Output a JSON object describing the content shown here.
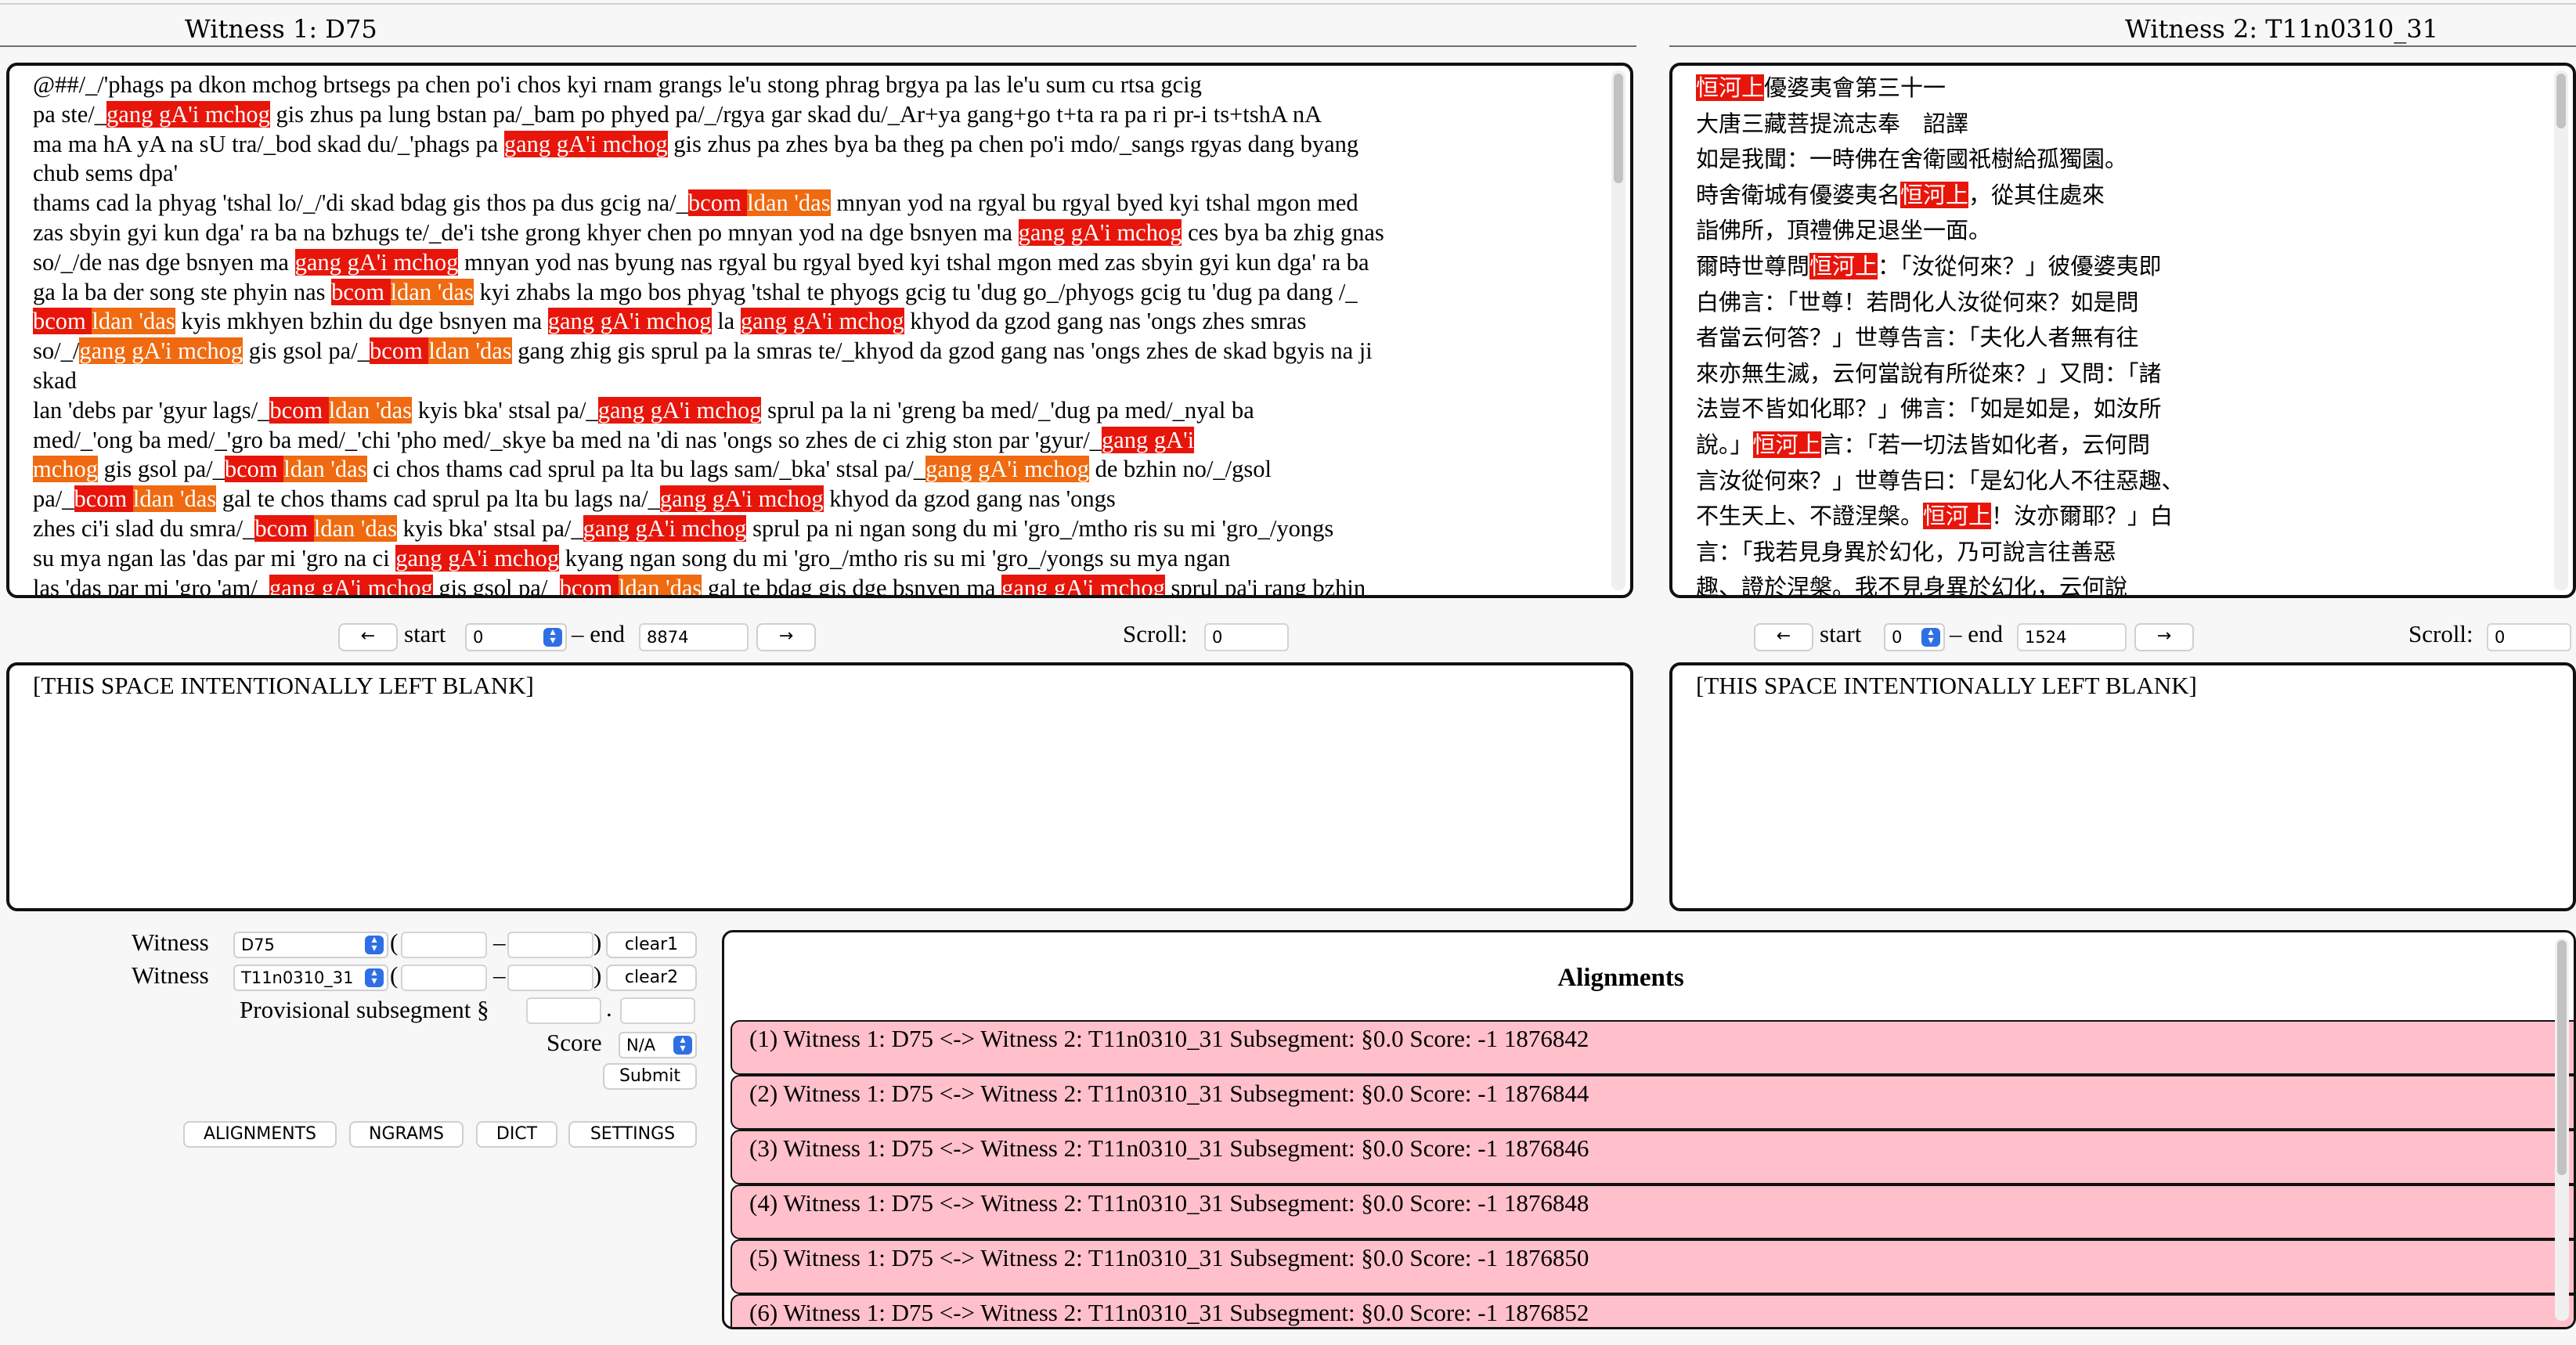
{
  "witness1": {
    "title": "Witness 1: D75",
    "lines": [
      [
        [
          "@##/_/'phags pa dkon mchog brtsegs pa chen po'i chos kyi rnam grangs le'u stong phrag brgya pa las le'u sum cu rtsa gcig",
          ""
        ]
      ],
      [
        [
          "pa ste/_",
          ""
        ],
        [
          "gang gA'i mchog",
          "a"
        ],
        [
          " gis zhus pa lung bstan pa/_bam po phyed pa/_/rgya gar skad du/_Ar+ya gang+go t+ta ra pa ri pr-i ts+tshA nA",
          ""
        ]
      ],
      [
        [
          "ma ma hA yA na sU tra/_bod skad du/_'phags pa ",
          ""
        ],
        [
          "gang gA'i mchog",
          "a"
        ],
        [
          " gis zhus pa zhes bya ba theg pa chen po'i mdo/_sangs rgyas dang byang",
          ""
        ]
      ],
      [
        [
          "chub sems dpa'",
          ""
        ]
      ],
      [
        [
          "thams cad la phyag 'tshal lo/_/'di skad bdag gis thos pa dus gcig na/_",
          ""
        ],
        [
          "bcom ",
          "a"
        ],
        [
          "ldan 'das",
          "b"
        ],
        [
          " mnyan yod na rgyal bu rgyal byed kyi tshal mgon med",
          ""
        ]
      ],
      [
        [
          "zas sbyin gyi kun dga' ra ba na bzhugs te/_de'i tshe grong khyer chen po mnyan yod na dge bsnyen ma ",
          ""
        ],
        [
          "gang gA'i mchog",
          "a"
        ],
        [
          " ces bya ba zhig gnas",
          ""
        ]
      ],
      [
        [
          "so/_/de nas dge bsnyen ma ",
          ""
        ],
        [
          "gang gA'i mchog",
          "a"
        ],
        [
          " mnyan yod nas byung nas rgyal bu rgyal byed kyi tshal mgon med zas sbyin gyi kun dga' ra ba",
          ""
        ]
      ],
      [
        [
          "ga la ba der song ste phyin nas ",
          ""
        ],
        [
          "bcom ",
          "a"
        ],
        [
          "ldan 'das",
          "b"
        ],
        [
          " kyi zhabs la mgo bos phyag 'tshal te phyogs gcig tu 'dug go_/phyogs gcig tu 'dug pa dang /_",
          ""
        ]
      ],
      [
        [
          "bcom ",
          "a"
        ],
        [
          "ldan 'das",
          "b"
        ],
        [
          " kyis mkhyen bzhin du dge bsnyen ma ",
          ""
        ],
        [
          "gang gA'i mchog",
          "a"
        ],
        [
          " la ",
          ""
        ],
        [
          "gang gA'i mchog",
          "a"
        ],
        [
          " khyod da gzod gang nas 'ongs zhes smras",
          ""
        ]
      ],
      [
        [
          "so/_/",
          ""
        ],
        [
          "gang gA'i mchog",
          "b"
        ],
        [
          " gis gsol pa/_",
          ""
        ],
        [
          "bcom ",
          "a"
        ],
        [
          "ldan 'das",
          "b"
        ],
        [
          " gang zhig gis sprul pa la smras te/_khyod da gzod gang nas 'ongs zhes de skad bgyis na ji",
          ""
        ]
      ],
      [
        [
          "skad",
          ""
        ]
      ],
      [
        [
          "lan 'debs par 'gyur lags/_",
          ""
        ],
        [
          "bcom ",
          "a"
        ],
        [
          "ldan 'das",
          "b"
        ],
        [
          " kyis bka' stsal pa/_",
          ""
        ],
        [
          "gang gA'i mchog",
          "a"
        ],
        [
          " sprul pa la ni 'greng ba med/_'dug pa med/_nyal ba",
          ""
        ]
      ],
      [
        [
          "med/_'ong ba med/_'gro ba med/_'chi 'pho med/_skye ba med na 'di nas 'ongs so zhes de ci zhig ston par 'gyur/_",
          ""
        ],
        [
          "gang gA'i",
          "a"
        ]
      ],
      [
        [
          "mchog",
          "b"
        ],
        [
          " gis gsol pa/_",
          ""
        ],
        [
          "bcom ",
          "a"
        ],
        [
          "ldan 'das",
          "b"
        ],
        [
          " ci chos thams cad sprul pa lta bu lags sam/_bka' stsal pa/_",
          ""
        ],
        [
          "gang gA'i mchog",
          "b"
        ],
        [
          " de bzhin no/_/gsol",
          ""
        ]
      ],
      [
        [
          "pa/_",
          ""
        ],
        [
          "bcom ",
          "a"
        ],
        [
          "ldan 'das",
          "b"
        ],
        [
          " gal te chos thams cad sprul pa lta bu lags na/_",
          ""
        ],
        [
          "gang gA'i mchog",
          "a"
        ],
        [
          " khyod da gzod gang nas 'ongs",
          ""
        ]
      ],
      [
        [
          "zhes ci'i slad du smra/_",
          ""
        ],
        [
          "bcom ",
          "a"
        ],
        [
          "ldan 'das",
          "b"
        ],
        [
          " kyis bka' stsal pa/_",
          ""
        ],
        [
          "gang gA'i mchog",
          "a"
        ],
        [
          " sprul pa ni ngan song du mi 'gro_/mtho ris su mi 'gro_/yongs",
          ""
        ]
      ],
      [
        [
          "su mya ngan las 'das par mi 'gro na ci ",
          ""
        ],
        [
          "gang gA'i mchog",
          "a"
        ],
        [
          " kyang ngan song du mi 'gro_/mtho ris su mi 'gro_/yongs su mya ngan",
          ""
        ]
      ],
      [
        [
          "las 'das par mi 'gro 'am/_",
          ""
        ],
        [
          "gang gA'i mchog",
          "a"
        ],
        [
          " gis gsol pa/_",
          ""
        ],
        [
          "bcom ",
          "a"
        ],
        [
          "ldan 'das",
          "b"
        ],
        [
          " gal te bdag gis dge bsnyen ma ",
          ""
        ],
        [
          "gang gA'i mchog",
          "a"
        ],
        [
          " sprul pa'i rang bzhin",
          ""
        ]
      ]
    ],
    "start_label": "start",
    "start_value": "0",
    "end_label": "– end",
    "end_value": "8874",
    "prev_glyph": "←",
    "next_glyph": "→",
    "scroll_label": "Scroll:",
    "scroll_value": "0",
    "blank_text": "[THIS SPACE INTENTIONALLY LEFT BLANK]"
  },
  "witness2": {
    "title": "Witness 2: T11n0310_31",
    "lines": [
      [
        [
          "恒河上",
          "a"
        ],
        [
          "優婆夷會第三十一",
          ""
        ]
      ],
      [
        [
          "大唐三藏菩提流志奉　詔譯",
          ""
        ]
      ],
      [
        [
          "如是我聞：一時佛在舍衛國祇樹給孤獨園。",
          ""
        ]
      ],
      [
        [
          "時舍衛城有優婆夷名",
          ""
        ],
        [
          "恒河上",
          "a"
        ],
        [
          "，從其住處來",
          ""
        ]
      ],
      [
        [
          "詣佛所，頂禮佛足退坐一面。",
          ""
        ]
      ],
      [
        [
          "爾時世尊問",
          ""
        ],
        [
          "恒河上",
          "a"
        ],
        [
          "：「汝從何來？」彼優婆夷即",
          ""
        ]
      ],
      [
        [
          "白佛言：「世尊！若問化人汝從何來？如是問",
          ""
        ]
      ],
      [
        [
          "者當云何答？」世尊告言：「夫化人者無有往",
          ""
        ]
      ],
      [
        [
          "來亦無生滅，云何當說有所從來？」又問：「諸",
          ""
        ]
      ],
      [
        [
          "法豈不皆如化耶？」佛言：「如是如是，如汝所",
          ""
        ]
      ],
      [
        [
          "說。」",
          ""
        ],
        [
          "恒河上",
          "a"
        ],
        [
          "言：「若一切法皆如化者，云何問",
          ""
        ]
      ],
      [
        [
          "言汝從何來？」世尊告曰：「是幻化人不往惡趣、",
          ""
        ]
      ],
      [
        [
          "不生天上、不證涅槃。",
          ""
        ],
        [
          "恒河上",
          "a"
        ],
        [
          "！汝亦爾耶？」白",
          ""
        ]
      ],
      [
        [
          "言：「我若見身異於幻化，乃可說言往善惡",
          ""
        ]
      ],
      [
        [
          "趣、證於涅槃。我不見身異於幻化，云何說",
          ""
        ]
      ]
    ],
    "start_label": "start",
    "start_value": "0",
    "end_label": "– end",
    "end_value": "1524",
    "prev_glyph": "←",
    "next_glyph": "→",
    "scroll_label": "Scroll:",
    "scroll_value": "0",
    "blank_text": "[THIS SPACE INTENTIONALLY LEFT BLANK]"
  },
  "form": {
    "witness_label": "Witness",
    "witness1_value": "D75",
    "witness2_value": "T11n0310_31",
    "paren_open": "(",
    "dash": "–",
    "paren_close": ")",
    "clear1_label": "clear1",
    "clear2_label": "clear2",
    "subsegment_label": "Provisional subsegment §",
    "subsegment_dot": ".",
    "score_label": "Score",
    "score_value": "N/A",
    "submit_label": "Submit"
  },
  "nav": {
    "alignments": "ALIGNMENTS",
    "ngrams": "NGRAMS",
    "dict": "DICT",
    "settings": "SETTINGS"
  },
  "alignments": {
    "heading": "Alignments",
    "rows": [
      "(1) Witness 1: D75 <-> Witness 2: T11n0310_31 Subsegment: §0.0 Score: -1 1876842",
      "(2) Witness 1: D75 <-> Witness 2: T11n0310_31 Subsegment: §0.0 Score: -1 1876844",
      "(3) Witness 1: D75 <-> Witness 2: T11n0310_31 Subsegment: §0.0 Score: -1 1876846",
      "(4) Witness 1: D75 <-> Witness 2: T11n0310_31 Subsegment: §0.0 Score: -1 1876848",
      "(5) Witness 1: D75 <-> Witness 2: T11n0310_31 Subsegment: §0.0 Score: -1 1876850",
      "(6) Witness 1: D75 <-> Witness 2: T11n0310_31 Subsegment: §0.0 Score: -1 1876852"
    ]
  },
  "colors": {
    "highlight_strong": "#e8150b",
    "highlight_medium": "#ef6a10",
    "alignment_row_bg": "#ffc0cb",
    "select_arrow": "#2f6fe6"
  }
}
